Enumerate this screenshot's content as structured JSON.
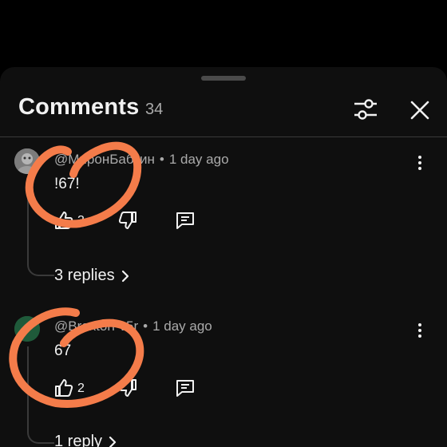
{
  "header": {
    "title": "Comments",
    "count": "34"
  },
  "comments": [
    {
      "author": "@МиронБабкин",
      "time": "1 day ago",
      "text": "!67!",
      "likes": "3",
      "replies_label": "3 replies"
    },
    {
      "author": "@Braxton-v5r",
      "time": "1 day ago",
      "text": "67",
      "likes": "2",
      "replies_label": "1 reply"
    }
  ],
  "colors": {
    "background": "#000000",
    "sheet": "#0f0f0f",
    "text": "#f1f1f1",
    "muted": "#aaaaaa",
    "annotation": "#f47c4a",
    "avatar2": "#1f5a3a"
  },
  "icons": [
    "filter-icon",
    "close-icon",
    "more-vert-icon",
    "thumb-up-icon",
    "thumb-down-icon",
    "reply-icon",
    "chevron-right-icon"
  ]
}
